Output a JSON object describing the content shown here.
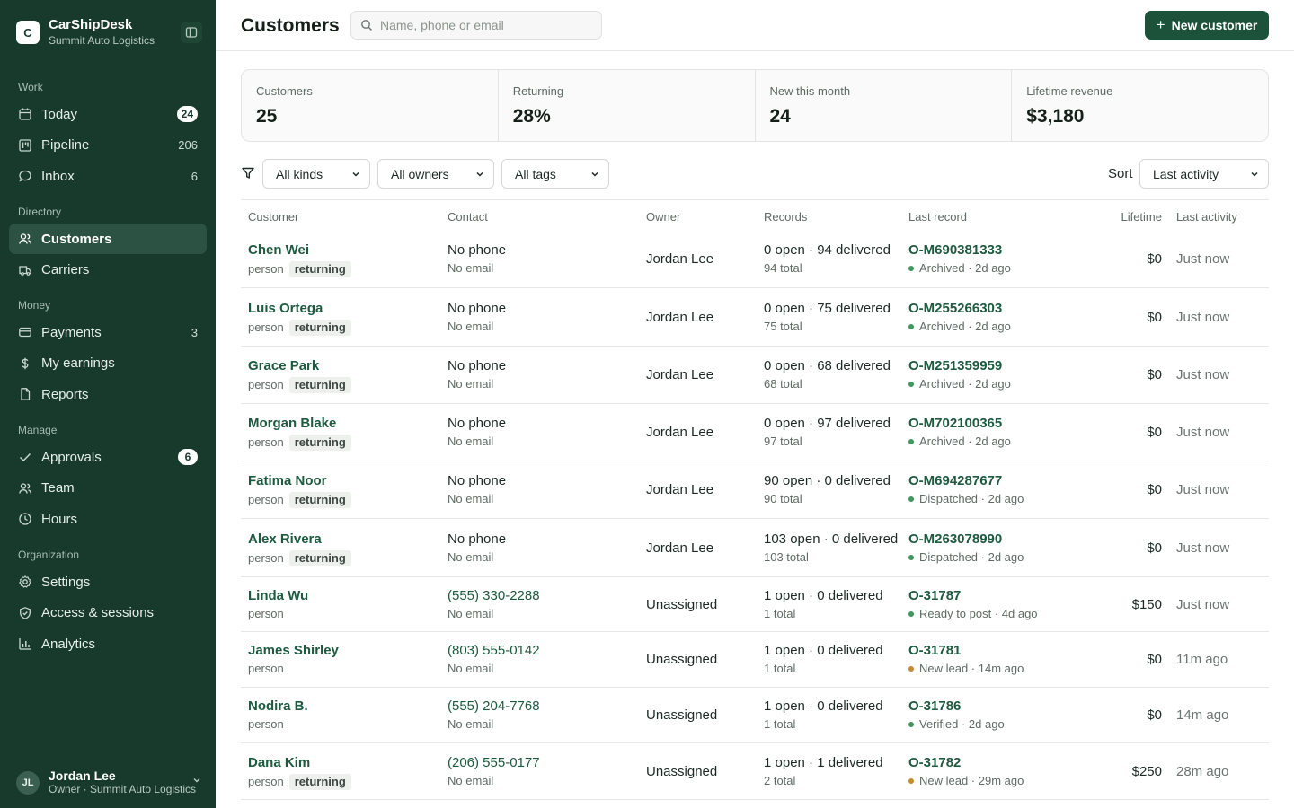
{
  "app": {
    "logo_letter": "C",
    "name": "CarShipDesk",
    "org": "Summit Auto Logistics"
  },
  "nav": {
    "sections": [
      {
        "title": "Work",
        "items": [
          {
            "label": "Today",
            "icon": "calendar-icon",
            "pill": "24"
          },
          {
            "label": "Pipeline",
            "icon": "kanban-icon",
            "count": "206"
          },
          {
            "label": "Inbox",
            "icon": "chat-icon",
            "count": "6"
          }
        ]
      },
      {
        "title": "Directory",
        "items": [
          {
            "label": "Customers",
            "icon": "users-icon",
            "active": true
          },
          {
            "label": "Carriers",
            "icon": "truck-icon"
          }
        ]
      },
      {
        "title": "Money",
        "items": [
          {
            "label": "Payments",
            "icon": "card-icon",
            "count": "3"
          },
          {
            "label": "My earnings",
            "icon": "dollar-icon"
          },
          {
            "label": "Reports",
            "icon": "file-icon"
          }
        ]
      },
      {
        "title": "Manage",
        "items": [
          {
            "label": "Approvals",
            "icon": "check-icon",
            "pill": "6"
          },
          {
            "label": "Team",
            "icon": "team-icon"
          },
          {
            "label": "Hours",
            "icon": "clock-icon"
          }
        ]
      },
      {
        "title": "Organization",
        "items": [
          {
            "label": "Settings",
            "icon": "gear-icon"
          },
          {
            "label": "Access & sessions",
            "icon": "shield-icon"
          },
          {
            "label": "Analytics",
            "icon": "bar-chart-icon"
          }
        ]
      }
    ]
  },
  "user": {
    "initials": "JL",
    "name": "Jordan Lee",
    "role": "Owner · Summit Auto Logistics"
  },
  "header": {
    "title": "Customers",
    "search_placeholder": "Name, phone or email",
    "new_button": "New customer"
  },
  "stats": [
    {
      "label": "Customers",
      "value": "25"
    },
    {
      "label": "Returning",
      "value": "28%"
    },
    {
      "label": "New this month",
      "value": "24"
    },
    {
      "label": "Lifetime revenue",
      "value": "$3,180"
    }
  ],
  "filters": {
    "kinds": "All kinds",
    "owners": "All owners",
    "tags": "All tags",
    "sort_label": "Sort",
    "sort_value": "Last activity"
  },
  "columns": [
    "Customer",
    "Contact",
    "Owner",
    "Records",
    "Last record",
    "Lifetime",
    "Last activity"
  ],
  "status_colors": {
    "green": "#3d9a5c",
    "amber": "#c98a2c"
  },
  "rows": [
    {
      "name": "Chen Wei",
      "kind": "person",
      "tag": "returning",
      "phone": "No phone",
      "email": "No email",
      "owner": "Jordan Lee",
      "records": "0 open · 94 delivered",
      "records_total": "94 total",
      "last_id": "O-M690381333",
      "last_status": "Archived · 2d ago",
      "status_color": "green",
      "lifetime": "$0",
      "activity": "Just now"
    },
    {
      "name": "Luis Ortega",
      "kind": "person",
      "tag": "returning",
      "phone": "No phone",
      "email": "No email",
      "owner": "Jordan Lee",
      "records": "0 open · 75 delivered",
      "records_total": "75 total",
      "last_id": "O-M255266303",
      "last_status": "Archived · 2d ago",
      "status_color": "green",
      "lifetime": "$0",
      "activity": "Just now"
    },
    {
      "name": "Grace Park",
      "kind": "person",
      "tag": "returning",
      "phone": "No phone",
      "email": "No email",
      "owner": "Jordan Lee",
      "records": "0 open · 68 delivered",
      "records_total": "68 total",
      "last_id": "O-M251359959",
      "last_status": "Archived · 2d ago",
      "status_color": "green",
      "lifetime": "$0",
      "activity": "Just now"
    },
    {
      "name": "Morgan Blake",
      "kind": "person",
      "tag": "returning",
      "phone": "No phone",
      "email": "No email",
      "owner": "Jordan Lee",
      "records": "0 open · 97 delivered",
      "records_total": "97 total",
      "last_id": "O-M702100365",
      "last_status": "Archived · 2d ago",
      "status_color": "green",
      "lifetime": "$0",
      "activity": "Just now"
    },
    {
      "name": "Fatima Noor",
      "kind": "person",
      "tag": "returning",
      "phone": "No phone",
      "email": "No email",
      "owner": "Jordan Lee",
      "records": "90 open · 0 delivered",
      "records_total": "90 total",
      "last_id": "O-M694287677",
      "last_status": "Dispatched · 2d ago",
      "status_color": "green",
      "lifetime": "$0",
      "activity": "Just now"
    },
    {
      "name": "Alex Rivera",
      "kind": "person",
      "tag": "returning",
      "phone": "No phone",
      "email": "No email",
      "owner": "Jordan Lee",
      "records": "103 open · 0 delivered",
      "records_total": "103 total",
      "last_id": "O-M263078990",
      "last_status": "Dispatched · 2d ago",
      "status_color": "green",
      "lifetime": "$0",
      "activity": "Just now"
    },
    {
      "name": "Linda Wu",
      "kind": "person",
      "tag": "",
      "phone": "(555) 330-2288",
      "email": "No email",
      "owner": "Unassigned",
      "records": "1 open · 0 delivered",
      "records_total": "1 total",
      "last_id": "O-31787",
      "last_status": "Ready to post · 4d ago",
      "status_color": "green",
      "lifetime": "$150",
      "activity": "Just now"
    },
    {
      "name": "James Shirley",
      "kind": "person",
      "tag": "",
      "phone": "(803) 555-0142",
      "email": "No email",
      "owner": "Unassigned",
      "records": "1 open · 0 delivered",
      "records_total": "1 total",
      "last_id": "O-31781",
      "last_status": "New lead · 14m ago",
      "status_color": "amber",
      "lifetime": "$0",
      "activity": "11m ago"
    },
    {
      "name": "Nodira B.",
      "kind": "person",
      "tag": "",
      "phone": "(555) 204-7768",
      "email": "No email",
      "owner": "Unassigned",
      "records": "1 open · 0 delivered",
      "records_total": "1 total",
      "last_id": "O-31786",
      "last_status": "Verified · 2d ago",
      "status_color": "green",
      "lifetime": "$0",
      "activity": "14m ago"
    },
    {
      "name": "Dana Kim",
      "kind": "person",
      "tag": "returning",
      "phone": "(206) 555-0177",
      "email": "No email",
      "owner": "Unassigned",
      "records": "1 open · 1 delivered",
      "records_total": "2 total",
      "last_id": "O-31782",
      "last_status": "New lead · 29m ago",
      "status_color": "amber",
      "lifetime": "$250",
      "activity": "28m ago"
    }
  ]
}
